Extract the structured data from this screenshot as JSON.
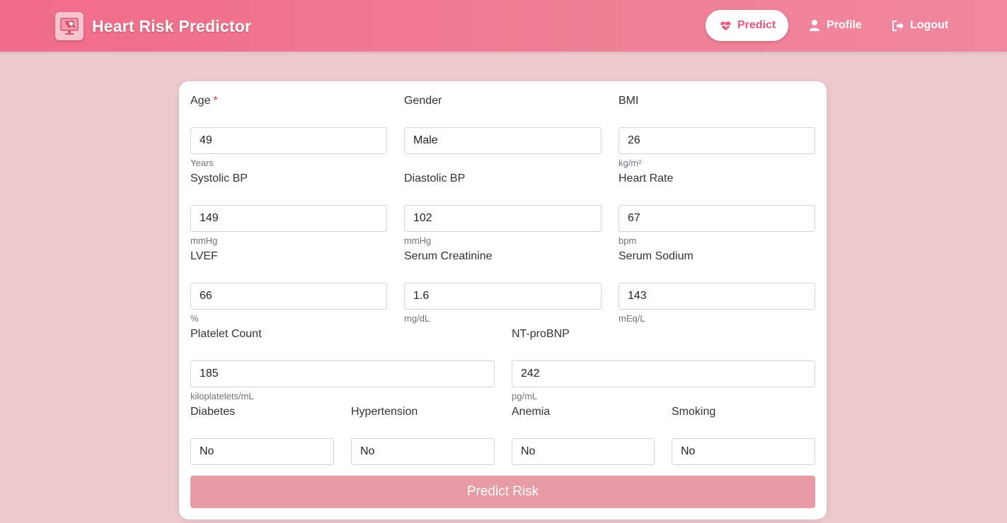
{
  "app": {
    "title": "Heart Risk Predictor"
  },
  "nav": {
    "predict": "Predict",
    "profile": "Profile",
    "logout": "Logout"
  },
  "form": {
    "age": {
      "label": "Age",
      "required_mark": "*",
      "value": "49",
      "hint": "Years"
    },
    "gender": {
      "label": "Gender",
      "value": "Male"
    },
    "bmi": {
      "label": "BMI",
      "value": "26",
      "hint": "kg/m²"
    },
    "systolic_bp": {
      "label": "Systolic BP",
      "value": "149",
      "hint": "mmHg"
    },
    "diastolic_bp": {
      "label": "Diastolic BP",
      "value": "102",
      "hint": "mmHg"
    },
    "heart_rate": {
      "label": "Heart Rate",
      "value": "67",
      "hint": "bpm"
    },
    "lvef": {
      "label": "LVEF",
      "value": "66",
      "hint": "%"
    },
    "serum_creatinine": {
      "label": "Serum Creatinine",
      "value": "1.6",
      "hint": "mg/dL"
    },
    "serum_sodium": {
      "label": "Serum Sodium",
      "value": "143",
      "hint": "mEq/L"
    },
    "platelet_count": {
      "label": "Platelet Count",
      "value": "185",
      "hint": "kiloplatelets/mL"
    },
    "nt_probnp": {
      "label": "NT-proBNP",
      "value": "242",
      "hint": "pg/mL"
    },
    "diabetes": {
      "label": "Diabetes",
      "value": "No"
    },
    "hypertension": {
      "label": "Hypertension",
      "value": "No"
    },
    "anemia": {
      "label": "Anemia",
      "value": "No"
    },
    "smoking": {
      "label": "Smoking",
      "value": "No"
    },
    "submit_label": "Predict Risk"
  },
  "colors": {
    "header_gradient_start": "#f06b8a",
    "header_gradient_end": "#f088a0",
    "page_background": "#ecc9cd",
    "active_nav_text": "#e8577a",
    "submit_button": "#e79ba5",
    "required_mark": "#dc3545"
  },
  "icons": {
    "brand": "heart-monitor-icon",
    "predict": "heart-pulse-icon",
    "profile": "user-icon",
    "logout": "logout-icon"
  }
}
